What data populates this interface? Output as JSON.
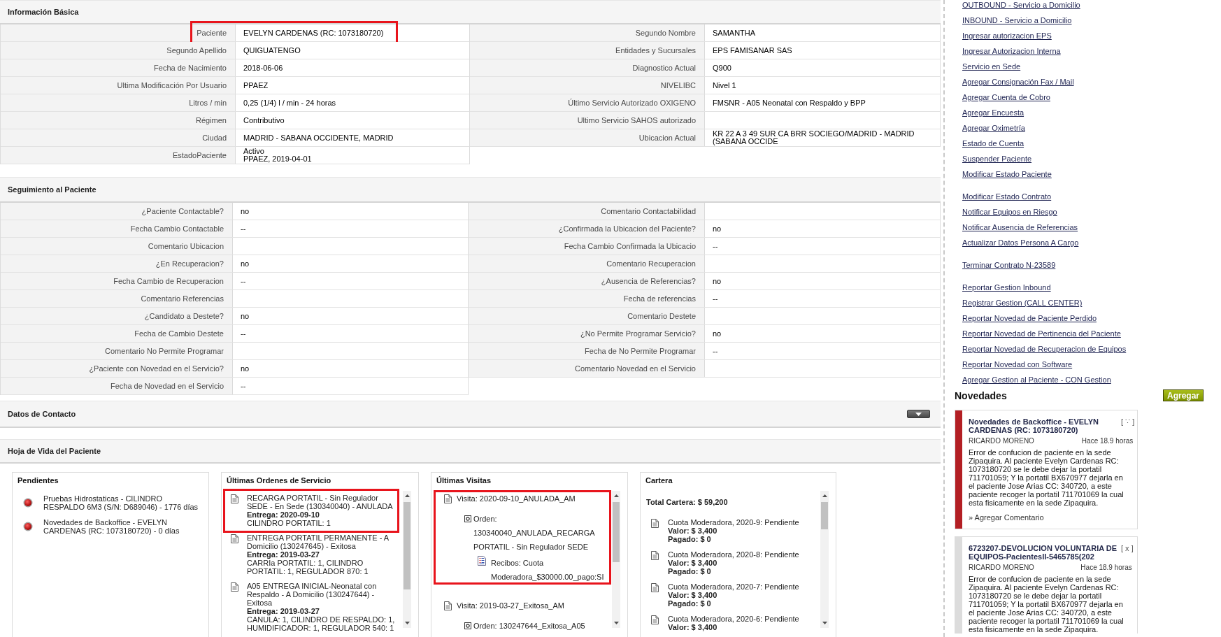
{
  "informacion_basica": {
    "title": "Información Básica",
    "left_rows": [
      {
        "label": "Paciente",
        "value": "EVELYN CARDENAS (RC: 1073180720)",
        "highlighted": true
      },
      {
        "label": "Segundo Apellido",
        "value": "QUIGUATENGO",
        "highlighted": false
      },
      {
        "label": "Fecha de Nacimiento",
        "value": "2018-06-06",
        "highlighted": false
      },
      {
        "label": "Ultima Modificación Por Usuario",
        "value": "PPAEZ",
        "highlighted": false
      },
      {
        "label": "Litros / min",
        "value": "0,25 (1/4) l / min - 24 horas",
        "highlighted": false
      },
      {
        "label": "Régimen",
        "value": "Contributivo",
        "highlighted": false
      },
      {
        "label": "Ciudad",
        "value": "MADRID - SABANA OCCIDENTE, MADRID",
        "highlighted": false
      },
      {
        "label": "EstadoPaciente",
        "value": "Activo",
        "detail": "PPAEZ, 2019-04-01",
        "highlighted": false
      }
    ],
    "right_rows": [
      {
        "label": "Segundo Nombre",
        "value": "SAMANTHA"
      },
      {
        "label": "Entidades y Sucursales",
        "value": "EPS FAMISANAR SAS"
      },
      {
        "label": "Diagnostico Actual",
        "value": "Q900"
      },
      {
        "label": "NIVELIBC",
        "value": "Nivel 1"
      },
      {
        "label": "Último Servicio Autorizado OXIGENO",
        "value": "FMSNR - A05 Neonatal con Respaldo y BPP"
      },
      {
        "label": "Ultimo Servicio SAHOS autorizado"
      },
      {
        "label": "Ubicacion Actual",
        "value": "KR 22 A 3 49 SUR CA BRR SOCIEGO/MADRID - MADRID (SABANA OCCIDE"
      }
    ]
  },
  "seguimiento": {
    "title": "Seguimiento al Paciente",
    "left_rows": [
      {
        "label": "¿Paciente Contactable?",
        "value": "no"
      },
      {
        "label": "Fecha Cambio Contactable",
        "value": "--"
      },
      {
        "label": "Comentario Ubicacion"
      },
      {
        "label": "¿En Recuperacion?",
        "value": "no"
      },
      {
        "label": "Fecha Cambio de Recuperacion",
        "value": "--"
      },
      {
        "label": "Comentario Referencias"
      },
      {
        "label": "¿Candidato a Destete?",
        "value": "no"
      },
      {
        "label": "Fecha de Cambio Destete",
        "value": "--"
      },
      {
        "label": "Comentario No Permite Programar"
      },
      {
        "label": "¿Paciente con Novedad en el Servicio?",
        "value": "no"
      },
      {
        "label": "Fecha de Novedad en el Servicio",
        "value": "--"
      }
    ],
    "right_rows": [
      {
        "label": "Comentario Contactabilidad"
      },
      {
        "label": "¿Confirmada la Ubicacion del Paciente?",
        "value": "no"
      },
      {
        "label": "Fecha Cambio Confirmada la Ubicacio",
        "value": "--"
      },
      {
        "label": "Comentario Recuperacion"
      },
      {
        "label": "¿Ausencia de Referencias?",
        "value": "no"
      },
      {
        "label": "Fecha de referencias",
        "value": "--"
      },
      {
        "label": "Comentario Destete"
      },
      {
        "label": "¿No Permite Programar Servicio?",
        "value": "no"
      },
      {
        "label": "Fecha de No Permite Programar",
        "value": "--"
      },
      {
        "label": "Comentario Novedad en el Servicio"
      }
    ]
  },
  "datos_contacto": {
    "title": "Datos de Contacto"
  },
  "hoja_de_vida": {
    "title": "Hoja de Vida del Paciente",
    "pendientes": {
      "title": "Pendientes",
      "items": [
        {
          "text": "Pruebas Hidrostaticas - CILINDRO RESPALDO 6M3 (S/N: D689046) - 1776 días"
        },
        {
          "text": "Novedades de Backoffice - EVELYN CARDENAS (RC: 1073180720) - 0 días"
        }
      ]
    },
    "ordenes": {
      "title": "Últimas Ordenes de Servicio",
      "items": [
        {
          "description": "RECARGA PORTATIL - Sin Regulador SEDE - En Sede (130340040) - ANULADA",
          "delivery": "Entrega: 2020-09-10",
          "equipment": "CILINDRO PORTATIL: 1",
          "highlighted": true
        },
        {
          "description": "ENTREGA PORTATIL PERMANENTE - A Domicilio (130247645) - Exitosa",
          "delivery": "Entrega: 2019-03-27",
          "equipment": "CARRIa PORTATIL: 1, CILINDRO PORTATIL: 1, REGULADOR 870: 1",
          "highlighted": false
        },
        {
          "description": "A05 ENTREGA INICIAL-Neonatal con Respaldo - A Domicilio (130247644) - Exitosa",
          "delivery": "Entrega: 2019-03-27",
          "equipment": "CANULA: 1, CILINDRO DE RESPALDO: 1, HUMIDIFICADOR: 1, REGULADOR 540: 1",
          "highlighted": false
        }
      ]
    },
    "visitas": {
      "title": "Últimas Visitas",
      "items": [
        {
          "visit": "Visita: 2020-09-10_ANULADA_AM",
          "order": "Orden: 130340040_ANULADA_RECARGA PORTATIL - Sin Regulador SEDE",
          "receipt": "Recibos: Cuota Moderadora_$30000.00_pago:SI",
          "highlighted": true
        },
        {
          "visit": "Visita: 2019-03-27_Exitosa_AM",
          "order": "Orden: 130247644_Exitosa_A05",
          "highlighted": false
        }
      ]
    },
    "cartera": {
      "title": "Cartera",
      "total": "Total Cartera: $ 59,200",
      "items": [
        {
          "concept": "Cuota Moderadora, 2020-9: Pendiente",
          "valor": "Valor: $ 3,400",
          "pagado": "Pagado: $ 0"
        },
        {
          "concept": "Cuota Moderadora, 2020-8: Pendiente",
          "valor": "Valor: $ 3,400",
          "pagado": "Pagado: $ 0"
        },
        {
          "concept": "Cuota Moderadora, 2020-7: Pendiente",
          "valor": "Valor: $ 3,400",
          "pagado": "Pagado: $ 0"
        },
        {
          "concept": "Cuota Moderadora, 2020-6: Pendiente",
          "valor": "Valor: $ 3,400"
        }
      ]
    }
  },
  "sidebar": {
    "link_groups": [
      {
        "links": [
          "OUTBOUND - Servicio a Domicilio",
          "INBOUND - Servicio a Domicilio",
          "Ingresar autorizacion EPS",
          "Ingresar Autorizacion Interna",
          "Servicio en Sede",
          "Agregar Consignación Fax / Mail",
          "Agregar Cuenta de Cobro",
          "Agregar Encuesta",
          "Agregar Oximetría",
          "Estado de Cuenta",
          "Suspender Paciente",
          "Modificar Estado Paciente"
        ]
      },
      {
        "links": [
          "Modificar Estado Contrato",
          "Notificar Equipos en Riesgo",
          "Notificar Ausencia de Referencias",
          "Actualizar Datos Persona A Cargo"
        ]
      },
      {
        "links": [
          "Terminar Contrato N-23589"
        ]
      },
      {
        "links": [
          "Reportar Gestion Inbound",
          "Registrar Gestion (CALL CENTER)",
          "Reportar Novedad de Paciente Perdido",
          "Reportar Novedad de Pertinencia del Paciente",
          "Reportar Novedad de Recuperacion de Equipos",
          "Reportar Novedad con Software",
          "Agregar Gestion al Paciente - CON Gestion"
        ]
      }
    ],
    "novedades": {
      "title": "Novedades",
      "add_button": "Agregar",
      "cards": [
        {
          "title": "Novedades de Backoffice - EVELYN CARDENAS (RC: 1073180720)",
          "toggle": "[ ∵ ]",
          "author": "RICARDO MORENO",
          "time": "Hace 18.9 horas",
          "body": "Error de confucion de paciente en la sede Zipaquira. Al paciente Evelyn Cardenas RC: 1073180720 se le debe dejar la portatil 711701059; Y la portatil BX670977 dejarla en el paciente Jose Arias CC: 340720, a este paciente recoger la portatil 711701069 la cual esta fisicamente en la sede Zipaquira.",
          "comment_link": "» Agregar Comentario",
          "color": "#b31f24"
        },
        {
          "title": "6723207-DEVOLUCION VOLUNTARIA DE EQUIPOS-PacientesII-5465785(202",
          "toggle": "[ x ]",
          "author": "RICARDO MORENO",
          "time": "Hace 18.9 horas",
          "body": "Error de confucion de paciente en la sede Zipaquira. Al paciente Evelyn Cardenas RC: 1073180720 se le debe dejar la portatil 711701059; Y la portatil BX670977 dejarla en el paciente Jose Arias CC: 340720, a este paciente recoger la portatil 711701069 la cual esta fisicamente en la sede Zipaquira.",
          "color": "#dcdcdc"
        }
      ]
    }
  }
}
